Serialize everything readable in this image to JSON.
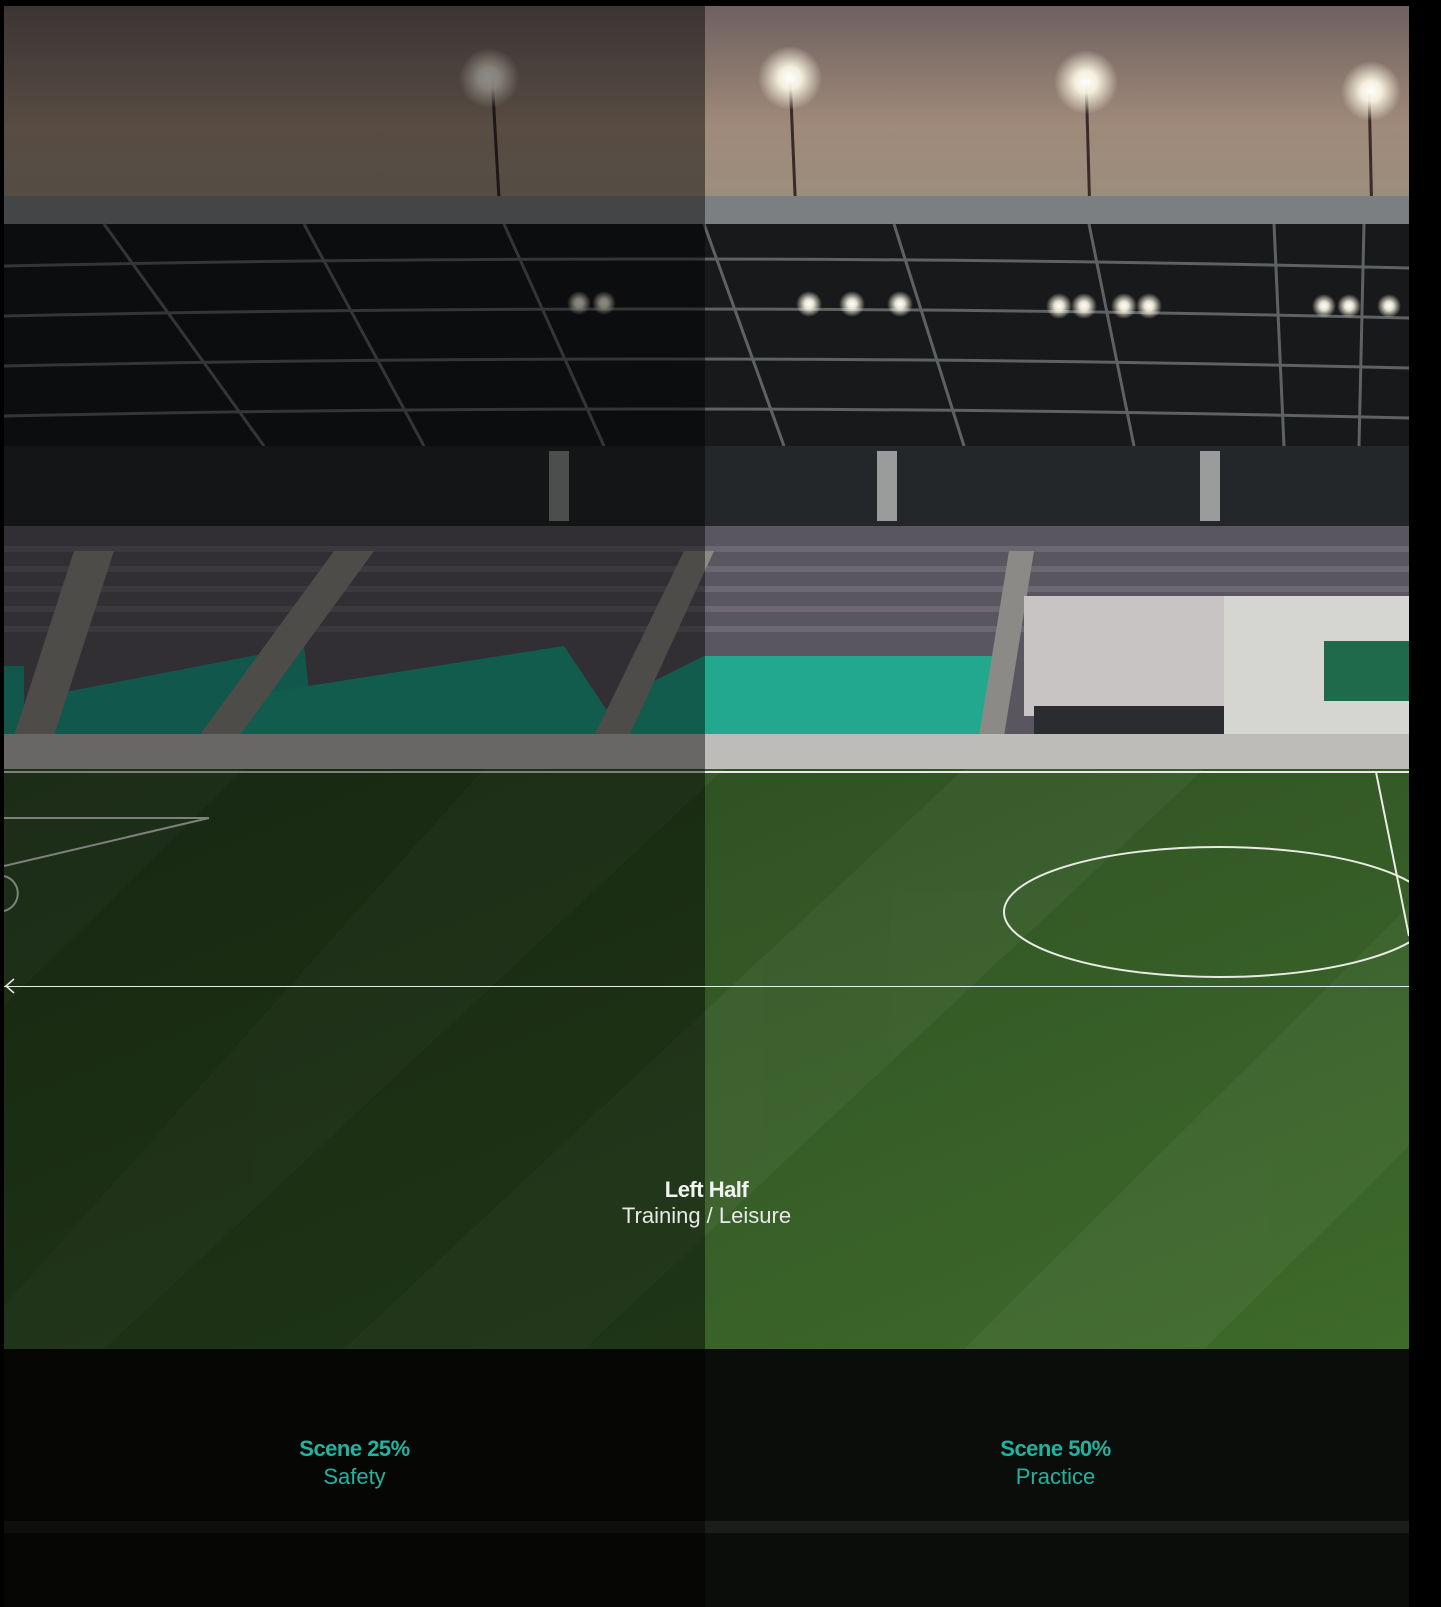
{
  "zone": {
    "title": "Left Half",
    "subtitle": "Training / Leisure"
  },
  "scenes": [
    {
      "name": "Scene 25%",
      "description": "Safety",
      "brightness": 0.25
    },
    {
      "name": "Scene 50%",
      "description": "Practice",
      "brightness": 0.5
    }
  ],
  "colors": {
    "accent": "#22b3a0",
    "text": "#ffffff"
  },
  "icons": {
    "slider_arrow": "arrow-left-icon"
  }
}
